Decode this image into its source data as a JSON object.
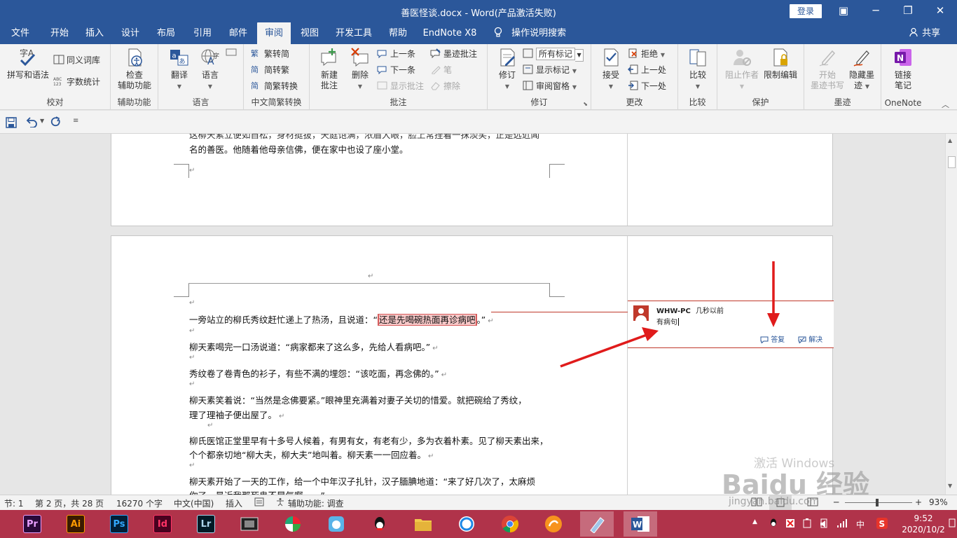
{
  "titlebar": {
    "title": "善医怪谈.docx - Word(产品激活失败)",
    "login": "登录",
    "minimize": "─",
    "restore": "❐",
    "close": "✕",
    "ribbon_display": "▣"
  },
  "tabs": [
    "文件",
    "开始",
    "插入",
    "设计",
    "布局",
    "引用",
    "邮件",
    "审阅",
    "视图",
    "开发工具",
    "帮助",
    "EndNote X8"
  ],
  "active_tab": "审阅",
  "tell_me": "操作说明搜索",
  "share": "共享",
  "ribbon": {
    "proofing": {
      "label": "校对",
      "spelling": "拼写和语法",
      "thesaurus": "同义词库",
      "wordcount": "字数统计"
    },
    "accessibility": {
      "label": "辅助功能",
      "check_line1": "检查",
      "check_line2": "辅助功能"
    },
    "language": {
      "label": "语言",
      "translate": "翻译",
      "language": "语言"
    },
    "chinese": {
      "label": "中文简繁转换",
      "to_trad": "繁转简",
      "to_simp": "简转繁",
      "convert": "简繁转换"
    },
    "comments": {
      "label": "批注",
      "new_line1": "新建",
      "new_line2": "批注",
      "delete": "删除",
      "prev": "上一条",
      "next": "下一条",
      "show": "显示批注",
      "ink": "墨迹批注",
      "pen": "笔",
      "erase": "擦除"
    },
    "tracking": {
      "label": "修订",
      "track": "修订",
      "markup_value": "所有标记",
      "show_markup": "显示标记",
      "pane": "审阅窗格"
    },
    "changes": {
      "label": "更改",
      "accept": "接受",
      "reject": "拒绝",
      "prev": "上一处",
      "next": "下一处"
    },
    "compare": {
      "label": "比较",
      "compare": "比较"
    },
    "protect": {
      "label": "保护",
      "block_line1": "阻止作者",
      "restrict_line1": "限制编辑"
    },
    "ink": {
      "label": "墨迹",
      "start_line1": "开始",
      "start_line2": "墨迹书写",
      "hide_line1": "隐藏墨",
      "hide_line2": "迹"
    },
    "onenote": {
      "label": "OneNote",
      "link_line1": "链接",
      "link_line2": "笔记"
    }
  },
  "document": {
    "page1_lines": [
      "这柳天素立便如自松，身材挺拔，天庭饱满，浓眉大眼，脸上常挂着一抹淡笑，正是远近闻",
      "名的善医。他随着他母亲信佛，便在家中也设了座小堂。"
    ],
    "para1_before": "一旁站立的柳氏秀纹赶忙递上了热汤，且说道：“",
    "para1_highlight": "还是先喝碗热面再诊病吧",
    "para1_after": "。”",
    "para2": "柳天素喝完一口汤说道：“病家都来了这么多，先给人看病吧。”",
    "para3": "秀纹卷了卷青色的衫子，有些不满的埋怨：“该吃面，再念佛的。”",
    "para4_line1": "柳天素笑着说：“当然是念佛要紧。”眼神里充满着对妻子关切的惜爱。就把碗给了秀纹，",
    "para4_line2": "理了理袖子便出屋了。",
    "para5_line1": "柳氏医馆正堂里早有十多号人候着，有男有女，有老有少，多为衣着朴素。见了柳天素出来，",
    "para5_line2": "个个都亲切地“柳大夫，柳大夫”地叫着。柳天素一一回应着。",
    "para6_line1": "柳天素开始了一天的工作，给一个中年汉子扎针，汉子腼腆地道：“来了好几次了，太麻烦",
    "para6_line2": "你了，最近我那死鬼不晃气啊……”",
    "pilcrow": "↵"
  },
  "comment": {
    "author": "WHW-PC",
    "time": "几秒以前",
    "text": "有病句",
    "reply": "答复",
    "resolve": "解决"
  },
  "statusbar": {
    "section": "节: 1",
    "page": "第 2 页，共 28 页",
    "words": "16270 个字",
    "language": "中文(中国)",
    "mode": "插入",
    "accessibility": "辅助功能: 调查",
    "zoom": "93%",
    "minus": "─",
    "plus": "+"
  },
  "taskbar": {
    "apps": [
      "Pr",
      "Ai",
      "Ps",
      "Id",
      "Lr"
    ],
    "ime": "中",
    "time": "9:52",
    "date": "2020/10/2"
  },
  "watermark": {
    "activate": "激活 Windows",
    "brand": "Baidu 经验",
    "url": "jingyan.baidu.com"
  },
  "colors": {
    "word_blue": "#2b579a",
    "taskbar": "#b0334a",
    "comment_red": "#c0392b",
    "arrow_red": "#e01b1b"
  }
}
